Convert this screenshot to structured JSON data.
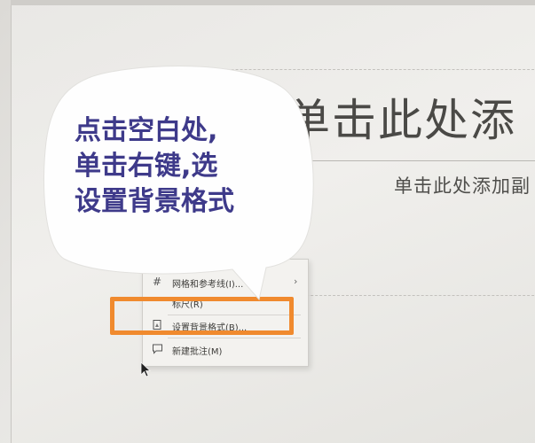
{
  "slide": {
    "title_placeholder": "单击此处添",
    "subtitle_placeholder": "单击此处添加副"
  },
  "context_menu": {
    "items": [
      {
        "label": "网格和参考线(I)...",
        "icon": "grid-icon",
        "has_submenu": true
      },
      {
        "label": "标尺(R)",
        "icon": "",
        "has_submenu": false
      },
      {
        "label": "设置背景格式(B)...",
        "icon": "format-background-icon",
        "has_submenu": false
      },
      {
        "label": "新建批注(M)",
        "icon": "comment-icon",
        "has_submenu": false
      }
    ]
  },
  "annotation": {
    "lines": [
      "点击空白处,",
      "单击右键,选",
      "设置背景格式"
    ],
    "highlight_color": "#f08a2e",
    "text_color": "#3e3a8a"
  }
}
